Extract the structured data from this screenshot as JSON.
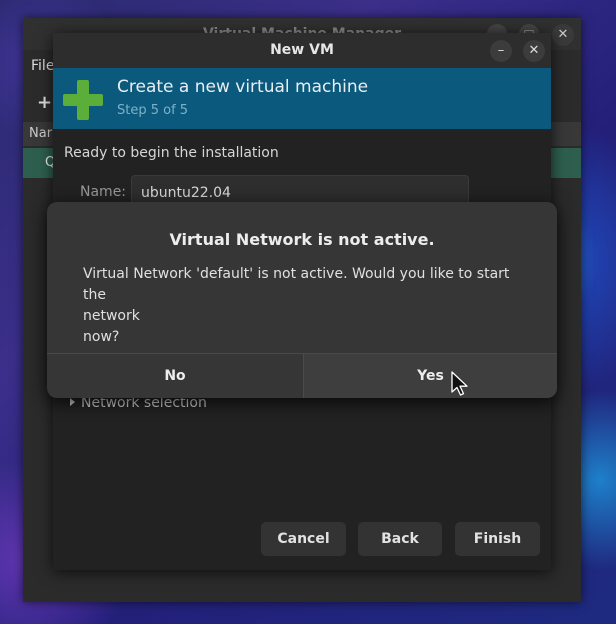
{
  "bg_window": {
    "title": "Virtual Machine Manager",
    "menu_file": "File",
    "add_glyph": "+",
    "header_name": "Nar",
    "row_label": "Q",
    "minimize_glyph": "–",
    "maximize_glyph": "□",
    "close_glyph": "✕"
  },
  "vm_window": {
    "title": "New VM",
    "minimize_glyph": "–",
    "close_glyph": "✕",
    "banner": {
      "icon": "plus-icon",
      "title": "Create a new virtual machine",
      "step": "Step 5 of 5"
    },
    "ready_text": "Ready to begin the installation",
    "name_label": "Name:",
    "name_value": "ubuntu22.04",
    "network_selection": "Network selection",
    "buttons": {
      "cancel": "Cancel",
      "back": "Back",
      "finish": "Finish"
    }
  },
  "dialog": {
    "title": "Virtual Network is not active.",
    "body_line1": "Virtual Network 'default' is not active. Would you like to start the",
    "body_line2": "network",
    "body_line3": "now?",
    "no_label": "No",
    "yes_label": "Yes"
  },
  "colors": {
    "banner": "#0b5a7e",
    "plus": "#5cae3a",
    "selected_row": "#2e5f4e"
  }
}
